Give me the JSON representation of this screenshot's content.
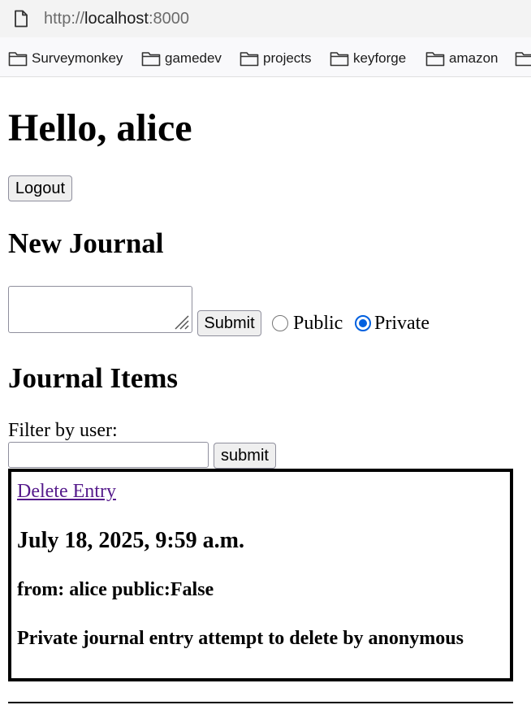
{
  "browser": {
    "url_scheme": "http://",
    "url_host": "localhost",
    "url_port": ":8000",
    "bookmarks": [
      {
        "label": "Surveymonkey",
        "icon": "folder-icon"
      },
      {
        "label": "gamedev",
        "icon": "folder-icon"
      },
      {
        "label": "projects",
        "icon": "folder-icon"
      },
      {
        "label": "keyforge",
        "icon": "folder-icon"
      },
      {
        "label": "amazon",
        "icon": "folder-icon"
      },
      {
        "label": "",
        "icon": "folder-icon"
      }
    ]
  },
  "page": {
    "greeting": "Hello, alice",
    "logout_label": "Logout",
    "new_journal_heading": "New Journal",
    "new_journal": {
      "entry_value": "",
      "submit_label": "Submit",
      "visibility_options": [
        {
          "label": "Public",
          "checked": false
        },
        {
          "label": "Private",
          "checked": true
        }
      ]
    },
    "journal_items_heading": "Journal Items",
    "filter": {
      "label": "Filter by user:",
      "value": "",
      "submit_label": "submit"
    },
    "entries": [
      {
        "delete_label": "Delete Entry",
        "date": "July 18, 2025, 9:59 a.m.",
        "meta": "from: alice public:False",
        "text": "Private journal entry attempt to delete by anonymous"
      }
    ]
  },
  "colors": {
    "link_visited": "#551a8b",
    "radio_accent": "#0060df",
    "address_bar_bg": "#f3f3f3",
    "bookmarks_bar_bg": "#f9f9fb"
  }
}
